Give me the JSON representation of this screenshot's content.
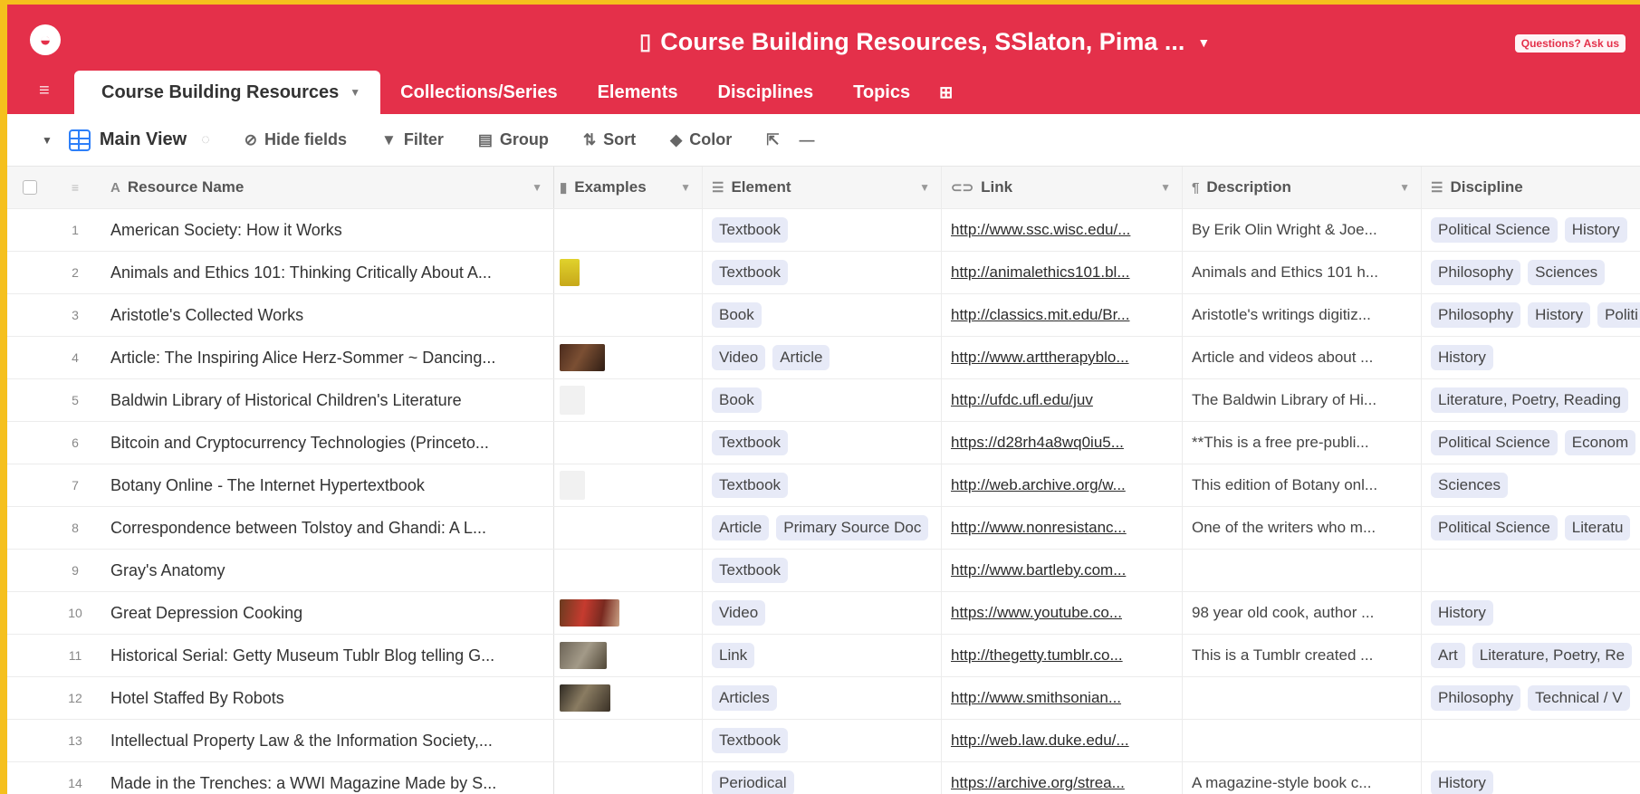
{
  "app": {
    "base_title": "Course Building Resources, SSlaton, Pima ...",
    "help_label": "Questions? Ask us"
  },
  "tabs": [
    {
      "label": "Course Building Resources",
      "active": true
    },
    {
      "label": "Collections/Series"
    },
    {
      "label": "Elements"
    },
    {
      "label": "Disciplines"
    },
    {
      "label": "Topics"
    }
  ],
  "toolbar": {
    "view_name": "Main View",
    "hide_fields": "Hide fields",
    "filter": "Filter",
    "group": "Group",
    "sort": "Sort",
    "color": "Color"
  },
  "columns": {
    "name": "Resource Name",
    "examples": "Examples",
    "element": "Element",
    "link": "Link",
    "description": "Description",
    "discipline": "Discipline"
  },
  "rows": [
    {
      "n": "1",
      "name": "American Society: How it Works",
      "thumb": "",
      "elements": [
        "Textbook"
      ],
      "link": "http://www.ssc.wisc.edu/...",
      "desc": "By Erik Olin Wright & Joe...",
      "disciplines": [
        "Political Science",
        "History"
      ]
    },
    {
      "n": "2",
      "name": "Animals and Ethics 101: Thinking Critically About A...",
      "thumb": "yellow",
      "elements": [
        "Textbook"
      ],
      "link": "http://animalethics101.bl...",
      "desc": "Animals and Ethics 101 h...",
      "disciplines": [
        "Philosophy",
        "Sciences"
      ]
    },
    {
      "n": "3",
      "name": "Aristotle's Collected Works",
      "thumb": "",
      "elements": [
        "Book"
      ],
      "link": "http://classics.mit.edu/Br...",
      "desc": "Aristotle's writings digitiz...",
      "disciplines": [
        "Philosophy",
        "History",
        "Politi"
      ]
    },
    {
      "n": "4",
      "name": "Article: The Inspiring Alice Herz-Sommer ~ Dancing...",
      "thumb": "brown",
      "elements": [
        "Video",
        "Article"
      ],
      "link": "http://www.arttherapyblo...",
      "desc": "Article and videos about ...",
      "disciplines": [
        "History"
      ]
    },
    {
      "n": "5",
      "name": "Baldwin Library of Historical Children's Literature",
      "thumb": "faint",
      "elements": [
        "Book"
      ],
      "link": "http://ufdc.ufl.edu/juv",
      "desc": "The Baldwin Library of Hi...",
      "disciplines": [
        "Literature, Poetry, Reading"
      ]
    },
    {
      "n": "6",
      "name": "Bitcoin and Cryptocurrency Technologies (Princeto...",
      "thumb": "",
      "elements": [
        "Textbook"
      ],
      "link": "https://d28rh4a8wq0iu5...",
      "desc": "**This is a free pre-publi...",
      "disciplines": [
        "Political Science",
        "Econom"
      ]
    },
    {
      "n": "7",
      "name": "Botany Online - The Internet Hypertextbook",
      "thumb": "faint",
      "elements": [
        "Textbook"
      ],
      "link": "http://web.archive.org/w...",
      "desc": "This edition of Botany onl...",
      "disciplines": [
        "Sciences"
      ]
    },
    {
      "n": "8",
      "name": "Correspondence between Tolstoy and Ghandi: A L...",
      "thumb": "",
      "elements": [
        "Article",
        "Primary Source Doc"
      ],
      "link": "http://www.nonresistanc...",
      "desc": "One of the writers who m...",
      "disciplines": [
        "Political Science",
        "Literatu"
      ]
    },
    {
      "n": "9",
      "name": "Gray's Anatomy",
      "thumb": "",
      "elements": [
        "Textbook"
      ],
      "link": "http://www.bartleby.com...",
      "desc": "",
      "disciplines": []
    },
    {
      "n": "10",
      "name": "Great Depression Cooking",
      "thumb": "red",
      "elements": [
        "Video"
      ],
      "link": "https://www.youtube.co...",
      "desc": "98 year old cook, author ...",
      "disciplines": [
        "History"
      ]
    },
    {
      "n": "11",
      "name": "Historical Serial: Getty Museum Tublr Blog telling G...",
      "thumb": "gray",
      "elements": [
        "Link"
      ],
      "link": "http://thegetty.tumblr.co...",
      "desc": "This is a Tumblr created ...",
      "disciplines": [
        "Art",
        "Literature, Poetry, Re"
      ]
    },
    {
      "n": "12",
      "name": "Hotel Staffed By Robots",
      "thumb": "dark",
      "elements": [
        "Articles"
      ],
      "link": "http://www.smithsonian...",
      "desc": "",
      "disciplines": [
        "Philosophy",
        "Technical / V"
      ]
    },
    {
      "n": "13",
      "name": "Intellectual Property Law & the Information Society,...",
      "thumb": "",
      "elements": [
        "Textbook"
      ],
      "link": "http://web.law.duke.edu/...",
      "desc": "",
      "disciplines": []
    },
    {
      "n": "14",
      "name": "Made in the Trenches: a WWI Magazine Made by S...",
      "thumb": "",
      "elements": [
        "Periodical"
      ],
      "link": "https://archive.org/strea...",
      "desc": "A magazine-style book c...",
      "disciplines": [
        "History"
      ]
    }
  ],
  "colors": {
    "brand": "#e4304a",
    "frame": "#f5c01d",
    "chip": "#e7eaf7",
    "view_icon": "#2d7ff9"
  },
  "icons": {
    "logo": "airtable-logo-icon",
    "base": "book-icon",
    "menu": "hamburger-menu-icon",
    "add_tab": "add-table-icon",
    "view": "grid-view-icon",
    "hide": "eye-slash-icon",
    "filter": "filter-icon",
    "group": "group-icon",
    "sort": "sort-icon",
    "color": "paint-bucket-icon",
    "share": "share-icon",
    "more": "more-icon"
  }
}
